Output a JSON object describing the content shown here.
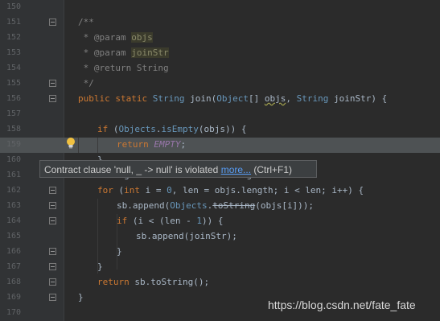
{
  "editor": {
    "lines": [
      {
        "num": "150",
        "parts": []
      },
      {
        "num": "151",
        "parts": [
          [
            "cm",
            "/**"
          ]
        ]
      },
      {
        "num": "152",
        "parts": [
          [
            "cm",
            " * "
          ],
          [
            "tag",
            "@param "
          ],
          [
            "param",
            "objs"
          ]
        ]
      },
      {
        "num": "153",
        "parts": [
          [
            "cm",
            " * "
          ],
          [
            "tag",
            "@param "
          ],
          [
            "param",
            "joinStr"
          ]
        ]
      },
      {
        "num": "154",
        "parts": [
          [
            "cm",
            " * "
          ],
          [
            "tag",
            "@return "
          ],
          [
            "cm",
            "String"
          ]
        ]
      },
      {
        "num": "155",
        "parts": [
          [
            "cm",
            " */"
          ]
        ]
      },
      {
        "num": "156",
        "parts": [
          [
            "kw",
            "public static "
          ],
          [
            "type",
            "String"
          ],
          [
            "plain",
            " join("
          ],
          [
            "type",
            "Object"
          ],
          [
            "plain",
            "[] "
          ],
          [
            "squig",
            "objs"
          ],
          [
            "plain",
            ", "
          ],
          [
            "type",
            "String"
          ],
          [
            "plain",
            " joinStr) {"
          ]
        ]
      },
      {
        "num": "157",
        "parts": []
      },
      {
        "num": "158",
        "parts": [
          [
            "kw",
            "if "
          ],
          [
            "plain",
            "("
          ],
          [
            "type",
            "Objects"
          ],
          [
            "plain",
            "."
          ],
          [
            "type",
            "isEmpty"
          ],
          [
            "plain",
            "(objs)) {"
          ]
        ]
      },
      {
        "num": "159",
        "parts": [
          [
            "kw",
            "return "
          ],
          [
            "field",
            "EMPTY"
          ],
          [
            "plain",
            ";"
          ]
        ]
      },
      {
        "num": "160",
        "parts": [
          [
            "plain",
            "}"
          ]
        ]
      },
      {
        "num": "161",
        "parts": [
          [
            "plain",
            "StringBuilder sb = new StringBuilder"
          ]
        ]
      },
      {
        "num": "162",
        "parts": [
          [
            "kw",
            "for "
          ],
          [
            "plain",
            "("
          ],
          [
            "kw",
            "int "
          ],
          [
            "plain",
            "i = "
          ],
          [
            "type",
            "0"
          ],
          [
            "plain",
            ", len = objs.length; i < len; i++) {"
          ]
        ]
      },
      {
        "num": "163",
        "parts": [
          [
            "plain",
            "sb.append("
          ],
          [
            "type",
            "Objects"
          ],
          [
            "plain",
            "."
          ],
          [
            "strike",
            "toString"
          ],
          [
            "plain",
            "(objs[i]));"
          ]
        ]
      },
      {
        "num": "164",
        "parts": [
          [
            "kw",
            "if "
          ],
          [
            "plain",
            "(i < (len - "
          ],
          [
            "type",
            "1"
          ],
          [
            "plain",
            ")) {"
          ]
        ]
      },
      {
        "num": "165",
        "parts": [
          [
            "plain",
            "sb.append(joinStr);"
          ]
        ]
      },
      {
        "num": "166",
        "parts": [
          [
            "plain",
            "}"
          ]
        ]
      },
      {
        "num": "167",
        "parts": [
          [
            "plain",
            "}"
          ]
        ]
      },
      {
        "num": "168",
        "parts": [
          [
            "kw",
            "return "
          ],
          [
            "plain",
            "sb.toString();"
          ]
        ]
      },
      {
        "num": "169",
        "parts": [
          [
            "plain",
            "}"
          ]
        ]
      },
      {
        "num": "170",
        "parts": []
      }
    ]
  },
  "tooltip": {
    "message": "Contract clause 'null, _ -> null' is violated ",
    "link": "more...",
    "shortcut": " (Ctrl+F1)"
  },
  "watermark": "https://blog.csdn.net/fate_fate",
  "colors": {
    "background": "#2b2b2b",
    "keyword": "#cc7832",
    "comment": "#808080",
    "highlight_line": "#4e5254",
    "link": "#589df6"
  }
}
